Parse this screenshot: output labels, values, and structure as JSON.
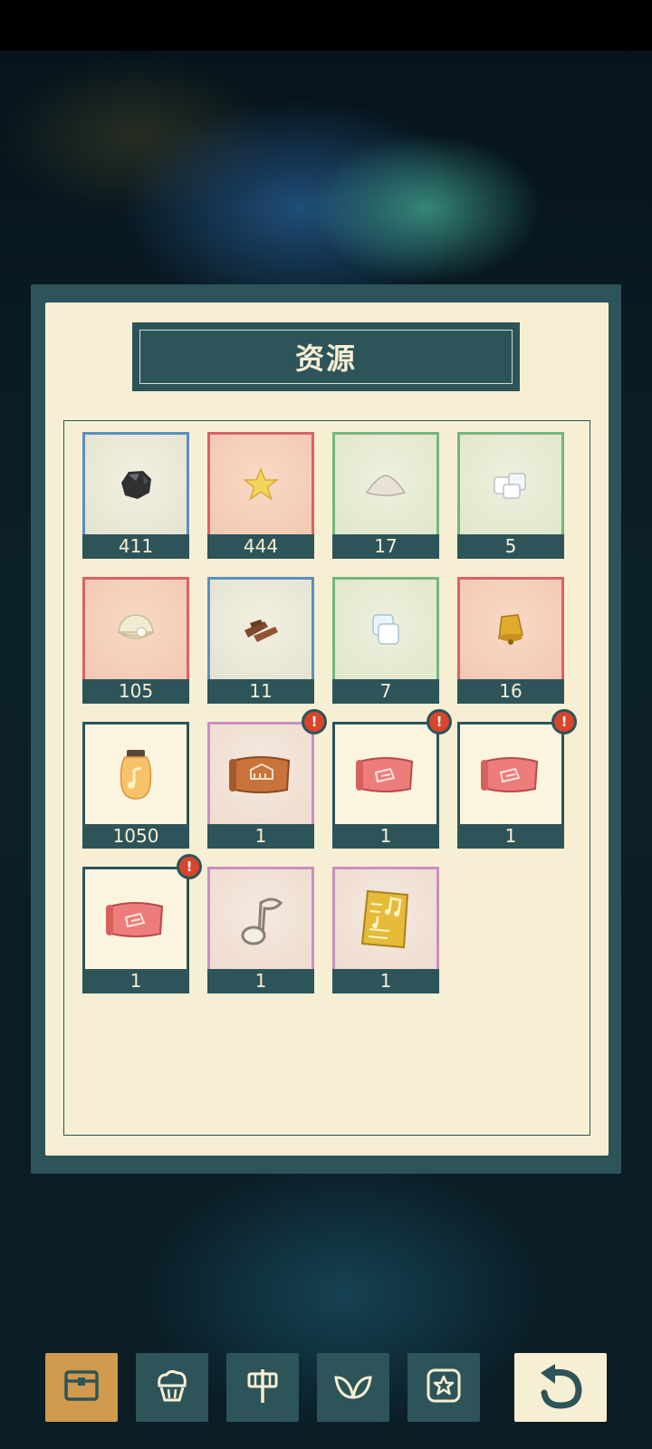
{
  "panel": {
    "title": "资源"
  },
  "items": [
    {
      "name": "coal",
      "icon": "coal-icon",
      "count": "411"
    },
    {
      "name": "star",
      "icon": "star-icon",
      "count": "444"
    },
    {
      "name": "salt",
      "icon": "salt-pile-icon",
      "count": "17"
    },
    {
      "name": "sugar-cubes",
      "icon": "sugar-cubes-icon",
      "count": "5"
    },
    {
      "name": "pearl-shell",
      "icon": "pearl-shell-icon",
      "count": "105"
    },
    {
      "name": "wood",
      "icon": "wood-planks-icon",
      "count": "11"
    },
    {
      "name": "ice-cube",
      "icon": "ice-cube-icon",
      "count": "7"
    },
    {
      "name": "bell",
      "icon": "bell-icon",
      "count": "16"
    },
    {
      "name": "music-jar",
      "icon": "music-jar-icon",
      "count": "1050"
    },
    {
      "name": "blueprint-orange",
      "icon": "blueprint-scroll-icon",
      "count": "1",
      "alert": "!"
    },
    {
      "name": "blueprint-red-1",
      "icon": "blueprint-scroll-icon",
      "count": "1",
      "alert": "!"
    },
    {
      "name": "blueprint-red-2",
      "icon": "blueprint-scroll-icon",
      "count": "1",
      "alert": "!"
    },
    {
      "name": "blueprint-red-3",
      "icon": "blueprint-scroll-icon",
      "count": "1",
      "alert": "!"
    },
    {
      "name": "music-note-outline",
      "icon": "music-note-icon",
      "count": "1"
    },
    {
      "name": "sheet-music",
      "icon": "sheet-music-icon",
      "count": "1"
    }
  ],
  "nav": {
    "tabs": [
      {
        "icon": "chest-icon",
        "active": true
      },
      {
        "icon": "cupcake-icon",
        "active": false
      },
      {
        "icon": "signpost-icon",
        "active": false
      },
      {
        "icon": "leaf-icon",
        "active": false
      },
      {
        "icon": "star-badge-icon",
        "active": false
      }
    ],
    "back": {
      "icon": "back-arrow-icon"
    }
  },
  "colors": {
    "panel_dark": "#2d5459",
    "panel_cream": "#f7efd3",
    "frame_blue": "#5b8fbf",
    "frame_red": "#d96266",
    "frame_green": "#74b77e",
    "frame_pink": "#c98fbf",
    "alert_red": "#d8442c",
    "active_tab": "#d19a4c"
  }
}
